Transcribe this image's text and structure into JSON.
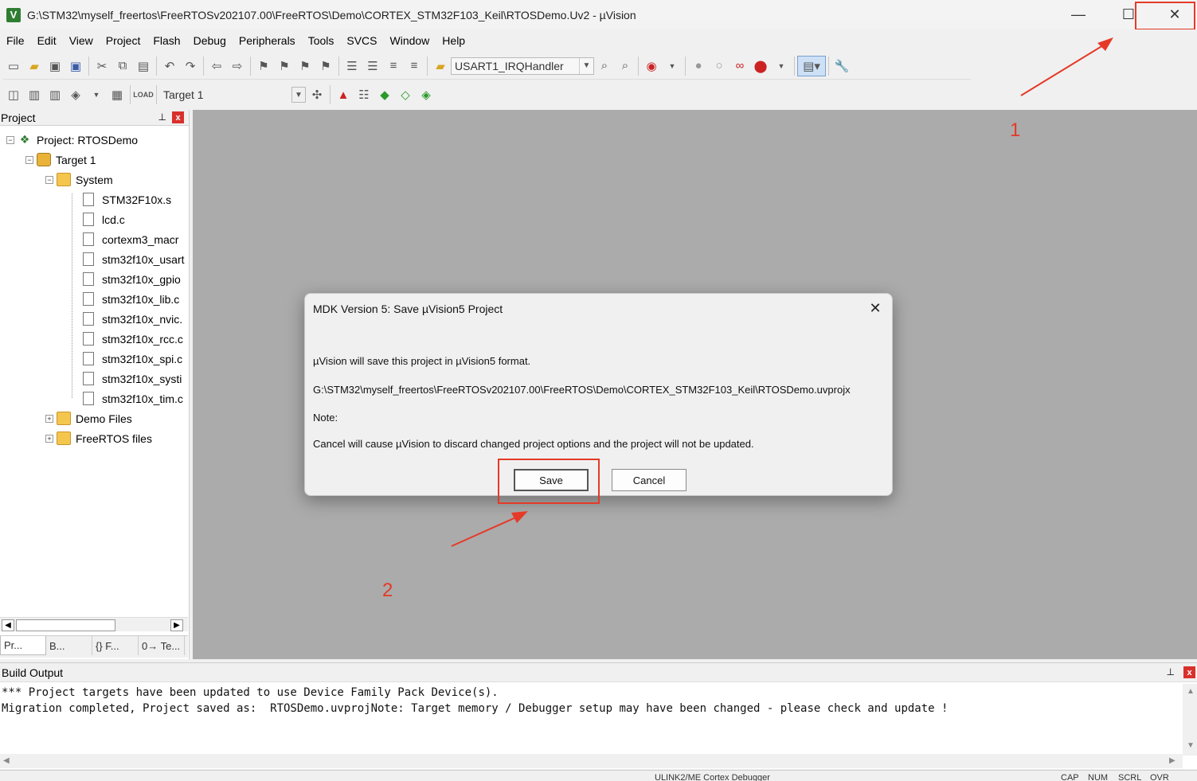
{
  "window": {
    "title": "G:\\STM32\\myself_freertos\\FreeRTOSv202107.00\\FreeRTOS\\Demo\\CORTEX_STM32F103_Keil\\RTOSDemo.Uv2 - µVision",
    "app_icon": "V",
    "minimize_glyph": "—",
    "maximize_glyph": "☐",
    "close_glyph": "✕"
  },
  "menu": [
    "File",
    "Edit",
    "View",
    "Project",
    "Flash",
    "Debug",
    "Peripherals",
    "Tools",
    "SVCS",
    "Window",
    "Help"
  ],
  "toolbar": {
    "function_combo": "USART1_IRQHandler",
    "target_combo": "Target 1"
  },
  "project_panel": {
    "title": "Project",
    "pin_glyph": "📌",
    "close_glyph": "x",
    "tree": {
      "project": "Project: RTOSDemo",
      "target": "Target 1",
      "system_group": "System",
      "files": [
        "STM32F10x.s",
        "lcd.c",
        "cortexm3_macr",
        "stm32f10x_usart",
        "stm32f10x_gpio",
        "stm32f10x_lib.c",
        "stm32f10x_nvic.",
        "stm32f10x_rcc.c",
        "stm32f10x_spi.c",
        "stm32f10x_systi",
        "stm32f10x_tim.c"
      ],
      "demo_files": "Demo Files",
      "freertos_files": "FreeRTOS files"
    },
    "tabs": [
      "Pr...",
      "B...",
      "{} F...",
      "0→ Te..."
    ]
  },
  "dialog": {
    "title": "MDK Version 5: Save µVision5 Project",
    "line1": "µVision will save this project in µVision5 format.",
    "line2": "G:\\STM32\\myself_freertos\\FreeRTOSv202107.00\\FreeRTOS\\Demo\\CORTEX_STM32F103_Keil\\RTOSDemo.uvprojx",
    "line3": "Note:",
    "line4": "Cancel will cause µVision to discard changed project options and the project will not be updated.",
    "save_label": "Save",
    "cancel_label": "Cancel",
    "close_glyph": "✕"
  },
  "annotations": {
    "step1": "1",
    "step2": "2",
    "color": "#e53a28"
  },
  "build_output": {
    "title": "Build Output",
    "lines": [
      "*** Project targets have been updated to use Device Family Pack Device(s).",
      "Migration completed, Project saved as:  RTOSDemo.uvprojNote: Target memory / Debugger setup may have been changed - please check and update !"
    ]
  },
  "statusbar": {
    "debugger": "ULINK2/ME Cortex Debugger",
    "cap": "CAP",
    "num": "NUM",
    "scrl": "SCRL",
    "ovr": "OVR"
  }
}
